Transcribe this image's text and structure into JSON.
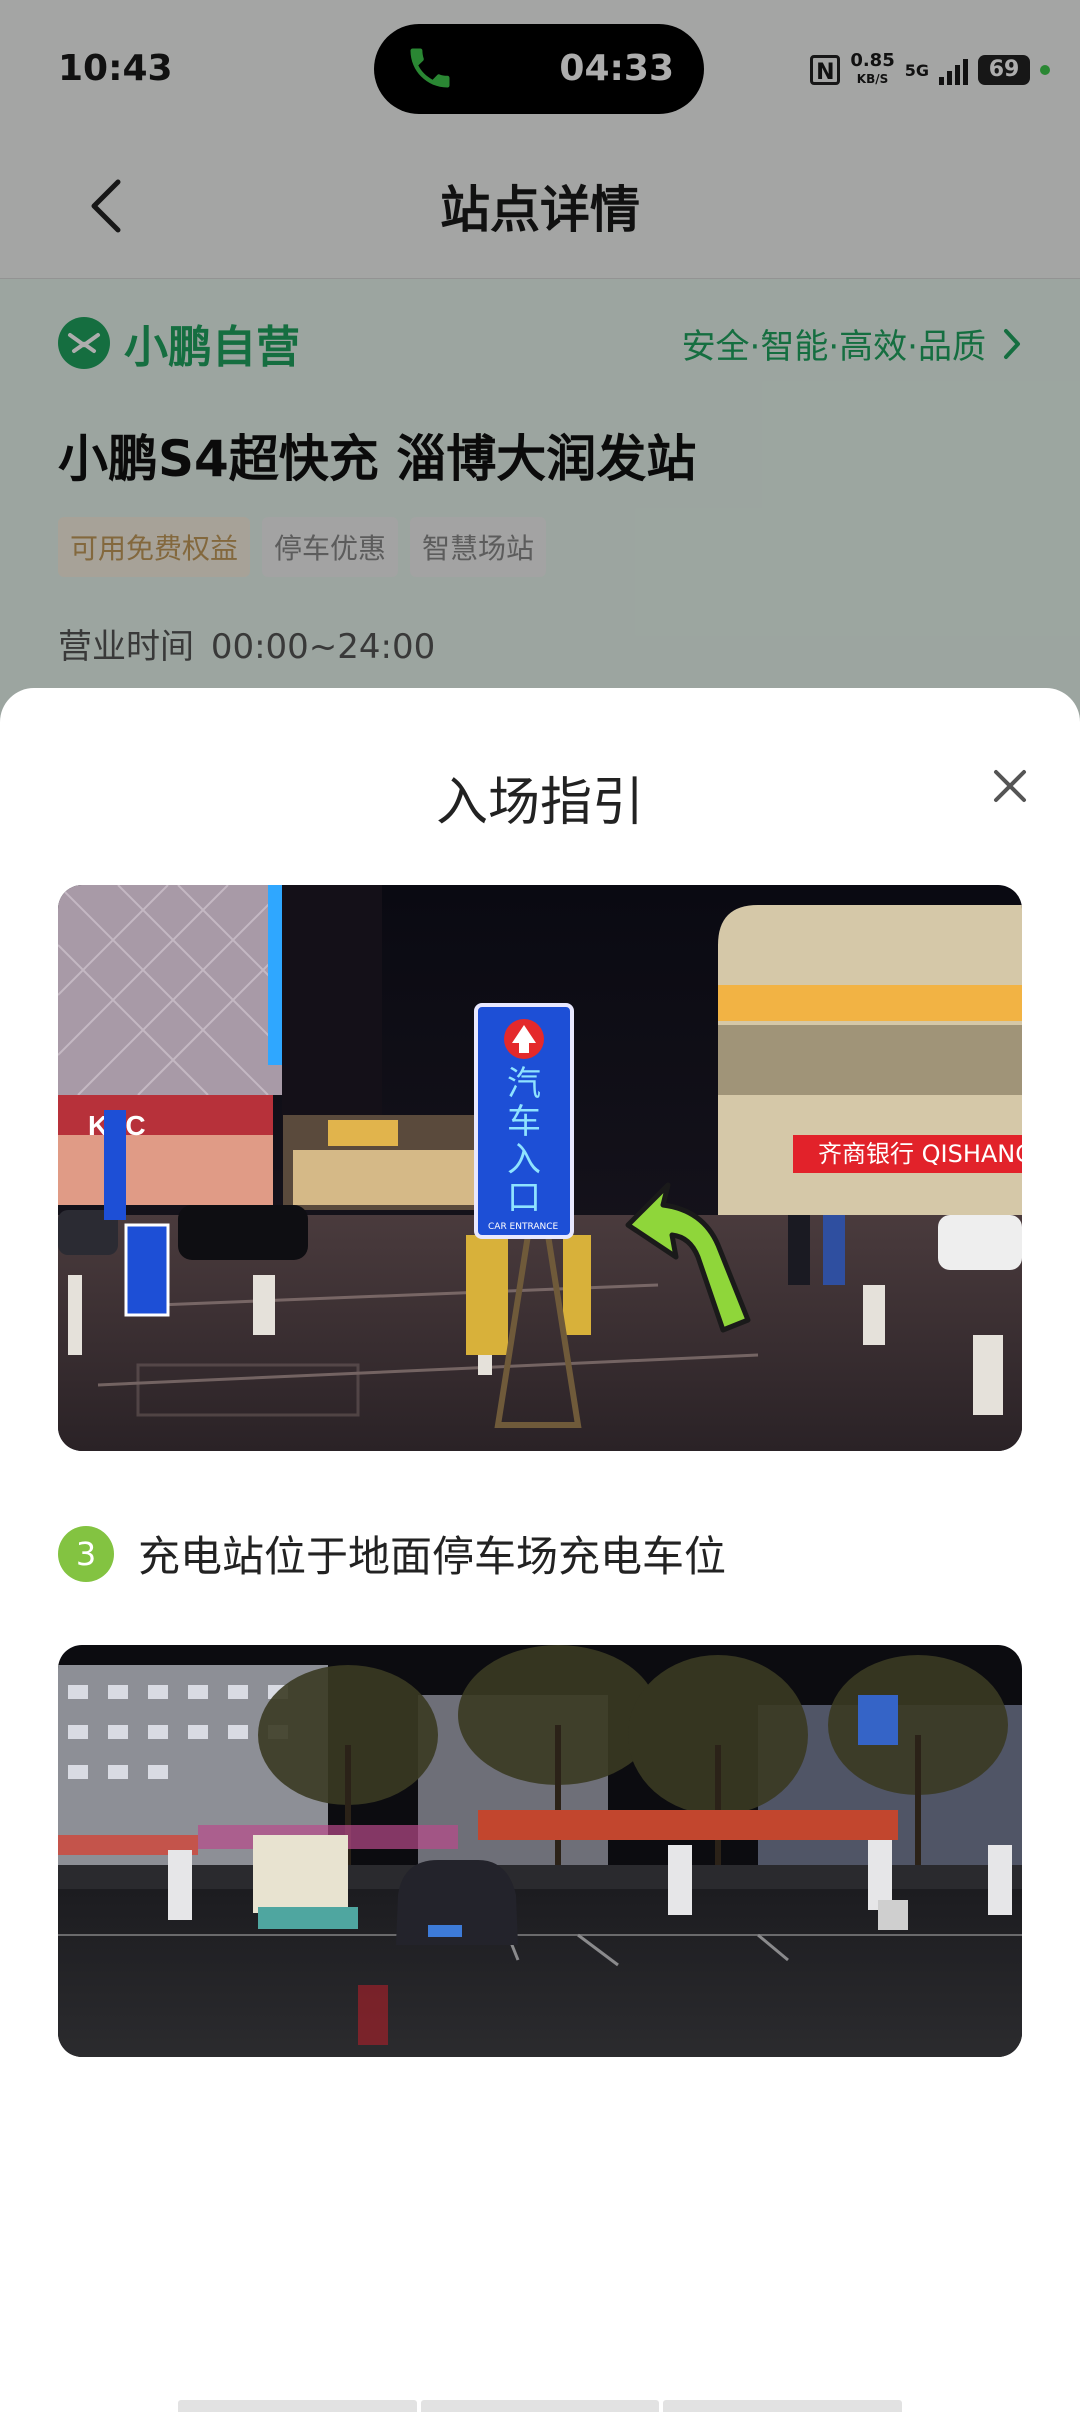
{
  "status_bar": {
    "time": "10:43",
    "call_time": "04:33",
    "nfc": "N",
    "net_speed": "0.85",
    "net_speed_unit": "KB/S",
    "signal_type": "5G",
    "battery": "69"
  },
  "header": {
    "title": "站点详情"
  },
  "station": {
    "brand": "小鹏自营",
    "slogan": "安全·智能·高效·品质",
    "name": "小鹏S4超快充 淄博大润发站",
    "tags": [
      "可用免费权益",
      "停车优惠",
      "智慧场站"
    ],
    "hours_label": "营业时间",
    "hours_value": "00:00~24:00"
  },
  "sheet": {
    "title": "入场指引",
    "step_number": "3",
    "step_text": "充电站位于地面停车场充电车位"
  },
  "photo1": {
    "sign_text": "汽车入口",
    "sign_sub": "CAR ENTRANCE",
    "kfc": "KFC",
    "bank": "齐商银行 QISHANG"
  },
  "colors": {
    "brand_green": "#1fa35f",
    "step_green": "#83c341",
    "arrow_green": "#8fd63a"
  }
}
